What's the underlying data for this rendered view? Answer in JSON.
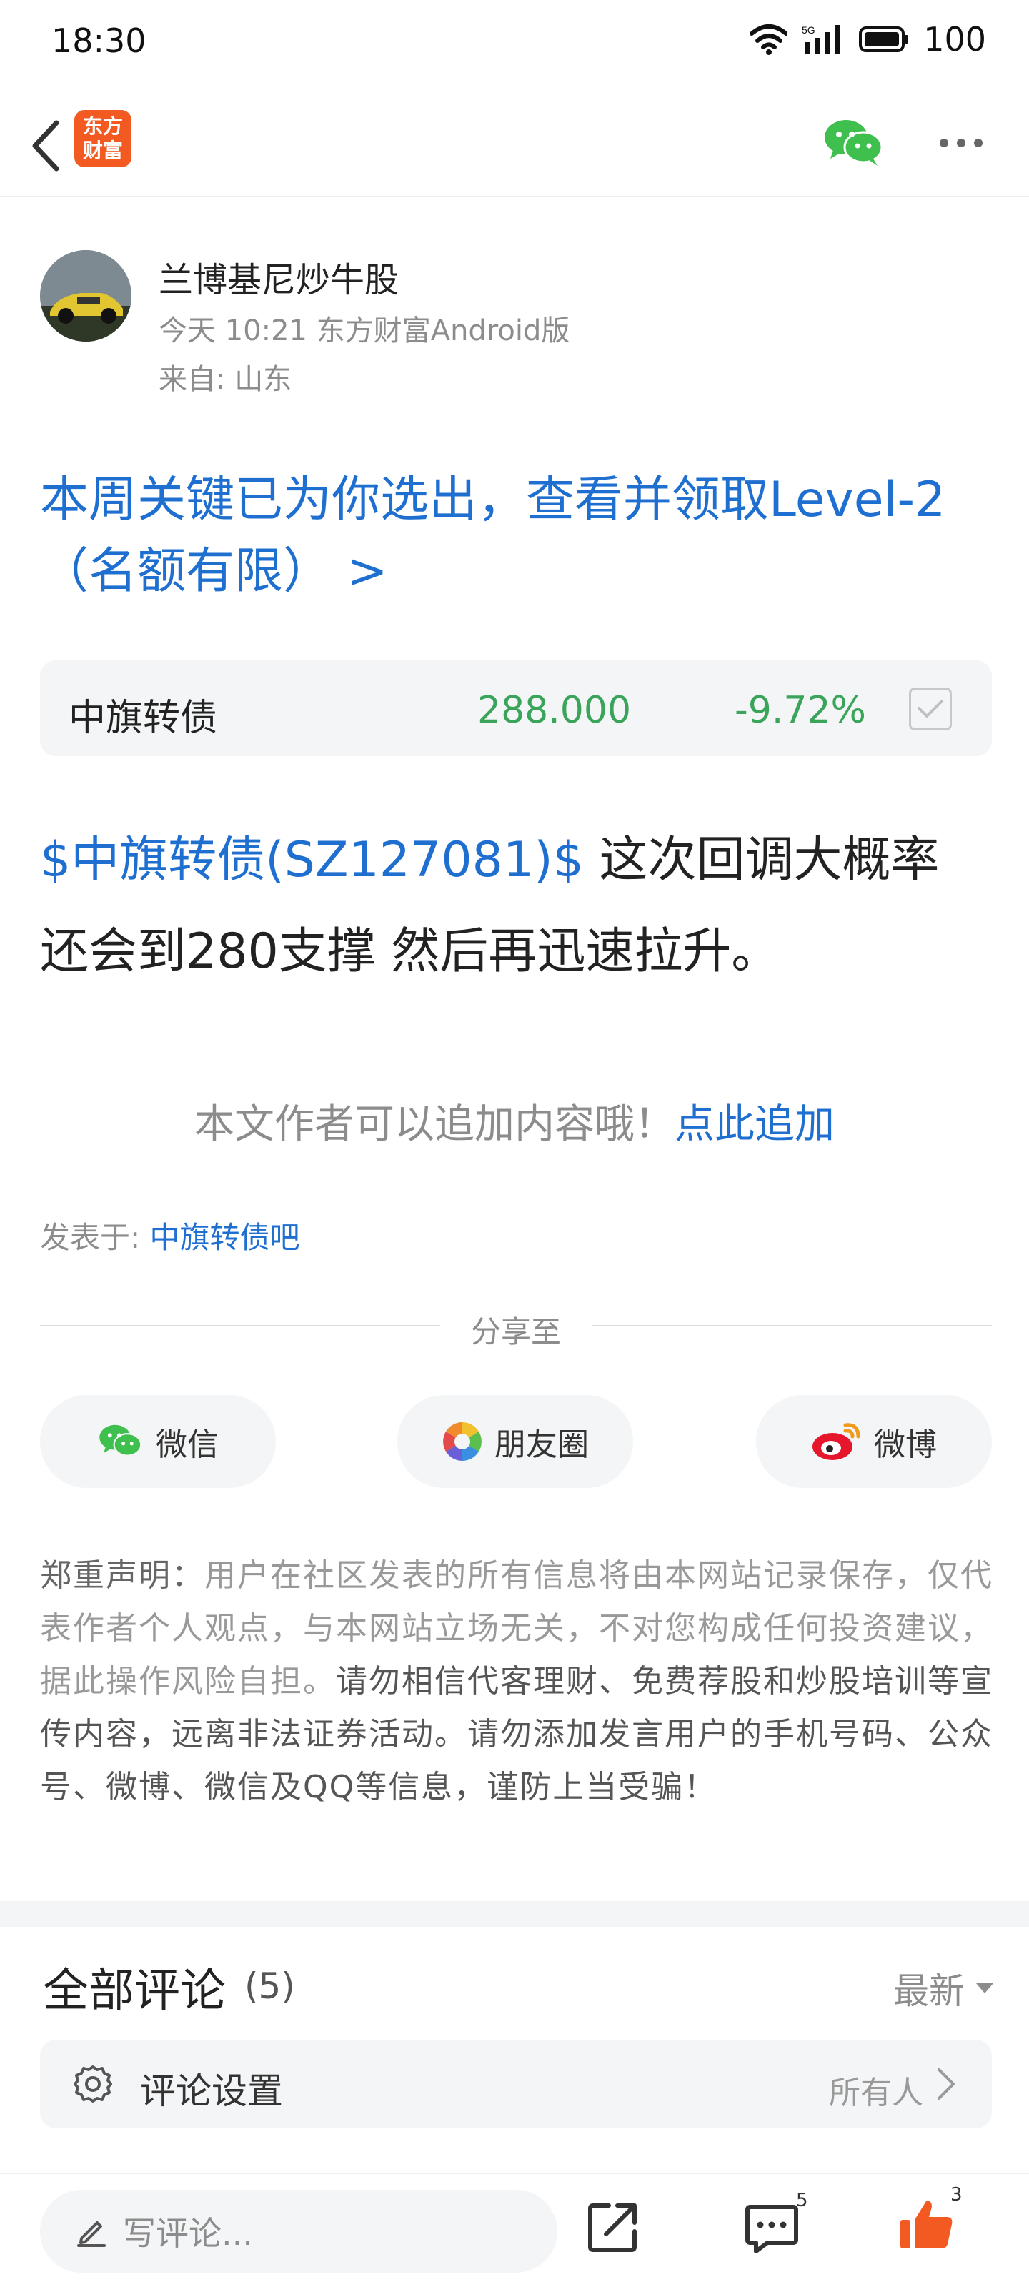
{
  "status_bar": {
    "time": "18:30",
    "battery": "100",
    "network": "5G",
    "icons": [
      "wifi-icon",
      "signal-icon",
      "battery-icon"
    ]
  },
  "nav": {
    "logo_line1": "东方",
    "logo_line2": "财富",
    "icons": [
      "back-arrow-icon",
      "wechat-icon",
      "more-icon"
    ]
  },
  "author": {
    "name": "兰博基尼炒牛股",
    "meta": "今天 10:21 东方财富Android版",
    "location": "来自: 山东"
  },
  "promo": {
    "line1": "本周关键已为你选出，查看并领取Level-2",
    "line2": "（名额有限） >"
  },
  "stock": {
    "name": "中旗转债",
    "price": "288.000",
    "change": "-9.72%",
    "change_color": "#3aa55a"
  },
  "post": {
    "stock_link": "$中旗转债(SZ127081)$",
    "text_part1": " 这次回调大概率",
    "text_part2": "还会到280支撑 然后再迅速拉升。"
  },
  "add_content": {
    "text": "本文作者可以追加内容哦！",
    "link": "点此追加"
  },
  "posted_in": {
    "label": "发表于: ",
    "bar": "中旗转债吧"
  },
  "share": {
    "label": "分享至",
    "wechat": "微信",
    "moments": "朋友圈",
    "weibo": "微博"
  },
  "disclaimer": {
    "title": "郑重声明：",
    "part1": "用户在社区发表的所有信息将由本网站记录保存，仅代表作者个人观点，与本网站立场无关，不对您构成任何投资建议，据此操作风险自担。",
    "part2": "请勿相信代客理财、免费荐股和炒股培训等宣传内容，远离非法证券活动。请勿添加发言用户的手机号码、公众号、微博、微信及QQ等信息，谨防上当受骗！"
  },
  "comments": {
    "title": "全部评论",
    "count": "(5)",
    "sort": "最新",
    "settings_label": "评论设置",
    "settings_value": "所有人"
  },
  "bottom_bar": {
    "placeholder": "写评论...",
    "comment_badge": "5",
    "like_badge": "3",
    "accent": "#f25a22"
  },
  "colors": {
    "link_blue": "#1f6fd1",
    "green": "#3aa55a",
    "brand_orange": "#f25a22"
  }
}
